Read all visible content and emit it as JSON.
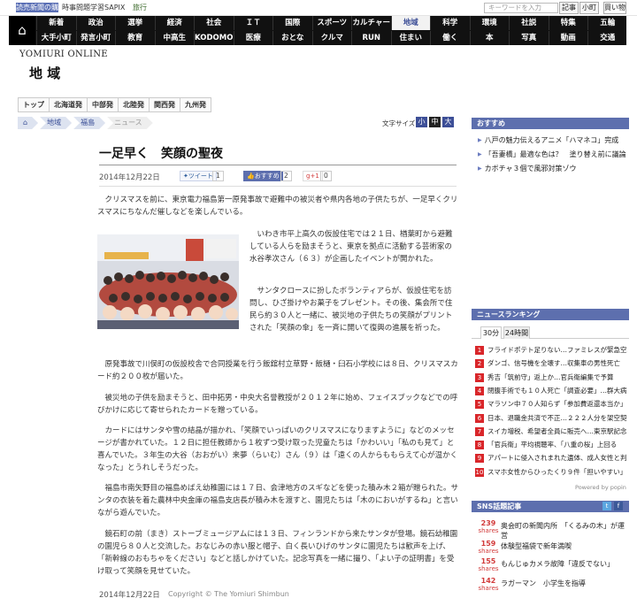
{
  "topbar": {
    "publisher": "読売新聞の購読",
    "links": [
      "時事問題学習SAPIX",
      "旅行"
    ],
    "search_placeholder": "キーワードを入力",
    "buttons": [
      "記事",
      "小町",
      "買い物"
    ]
  },
  "nav": {
    "row1": [
      "新着",
      "政治",
      "選挙",
      "経済",
      "社会",
      "ＩＴ",
      "国際",
      "スポーツ",
      "カルチャー",
      "地域",
      "科学",
      "環境",
      "社説",
      "特集",
      "五輪"
    ],
    "row2": [
      "大手小町",
      "発言小町",
      "教育",
      "中高生",
      "KODOMO",
      "医療",
      "おとな",
      "クルマ",
      "RUN",
      "住まい",
      "働く",
      "本",
      "写真",
      "動画",
      "交通"
    ],
    "active": "地域"
  },
  "brand": "YOMIURI ONLINE",
  "section_title": "地 域",
  "subtabs": [
    "トップ",
    "北海道発",
    "中部発",
    "北陸発",
    "関西発",
    "九州発"
  ],
  "breadcrumb": [
    "",
    "地域",
    "福島",
    "ニュース"
  ],
  "text_size": {
    "label": "文字サイズ",
    "options": [
      "小",
      "中",
      "大"
    ]
  },
  "article": {
    "title": "一足早く　笑顔の聖夜",
    "date": "2014年12月22日",
    "social": [
      {
        "label": "ツイート",
        "count": "1"
      },
      {
        "label": "おすすめ",
        "count": "2"
      },
      {
        "label": "+1",
        "count": "0"
      }
    ],
    "lead": "クリスマスを前に、東京電力福島第一原発事故で避難中の被災者や県内各地の子供たちが、一足早くクリスマスにちなんだ催しなどを楽しんでいる。",
    "p1": "いわき市平上高久の仮設住宅では２１日、楢葉町から避難している人らを励まそうと、東京を拠点に活動する芸術家の水谷孝次さん（６３）が企画したイベントが開かれた。",
    "p2": "サンタクロースに扮したボランティアらが、仮設住宅を訪問し、ひざ掛けやお菓子をプレゼント。その後、集会所で住民ら約３０人と一緒に、被災地の子供たちの笑顔がプリントされた「笑顔の傘」を一斉に開いて復興の進展を祈った。",
    "p3": "原発事故で川俣町の仮設校舎で合同授業を行う飯舘村立草野・飯樋・臼石小学校には８日、クリスマスカード約２００枚が届いた。",
    "p4": "被災地の子供を励まそうと、田中拓男・中央大名誉教授が２０１２年に始め、フェイスブックなどでの呼びかけに応じて寄せられたカードを贈っている。",
    "p5": "カードにはサンタや雪の結晶が描かれ、「笑顔でいっぱいのクリスマスになりますように」などのメッセージが書かれていた。１２日に担任教師から１枚ずつ受け取った児童たちは「かわいい」「私のも見て」と喜んでいた。３年生の大谷（おおがい）来夢（らいむ）さん（９）は「遠くの人からももらえて心が温かくなった」とうれしそうだった。",
    "p6": "福島市南矢野目の福島めばえ幼稚園には１７日、会津地方のスギなどを使った積み木２箱が贈られた。サンタの衣装を着た農林中央金庫の福島支店長が積み木を渡すと、園児たちは「木のにおいがするね」と言いながら遊んでいた。",
    "p7": "鏡石町の前（まき）ストーブミュージアムには１３日、フィンランドから来たサンタが登場。鏡石幼稚園の園児ら８０人と交流した。おなじみの赤い服と帽子、白く長いひげのサンタに園児たちは歓声を上げ、「新幹線のおもちゃをください」などと話しかけていた。記念写真を一緒に撮り、「よい子の証明書」を受け取って笑顔を見せていた。",
    "footer_date": "2014年12月22日",
    "copyright": "Copyright © The Yomiuri Shimbun"
  },
  "sidebar": {
    "recommend_title": "おすすめ",
    "recommend": [
      "八戸の魅力伝えるアニメ「ハマネコ」完成",
      "「吾妻橋」最適な色は？　塗り替え前に議論",
      "カボチャ３個で風邪対策ゾウ"
    ],
    "ranking_title": "ニュースランキング",
    "ranking_tabs": [
      "30分",
      "24時間"
    ],
    "ranking": [
      "フライドポテト足りない…ファミレスが緊急空輸",
      "ダンゴ、信号機を全壊す…収集車の男性死亡",
      "秀吉「筑前守」返上か…官兵衛編集で予算",
      "閉腹手術でも１０人死亡「調査必要」…群大病院",
      "マラソン中７０人知らず「参加費返還本当か」",
      "日本、退職金共済で不正…２２２人分を架空契約",
      "スイカ増税、希望者全員に販売へ…東京駅記念",
      "「官兵衛」平均視聴率、「八重の桜」上回る",
      "アパートに侵入されまれた遺体、成人女性と判明",
      "スマホ女性からひったくり９件「担いやすい」"
    ],
    "powered": "Powered by popin",
    "sns_title": "SNS話題記事",
    "sns": [
      {
        "count": "239",
        "unit": "shares",
        "text": "奥会町の新聞内所　「くるみの木」が運営"
      },
      {
        "count": "159",
        "unit": "shares",
        "text": "体験型福袋で新年満喫"
      },
      {
        "count": "155",
        "unit": "shares",
        "text": "もんじゅカメラ故障「違反でない」"
      },
      {
        "count": "142",
        "unit": "shares",
        "text": "ラガーマン　小学生を指導"
      }
    ],
    "colors": {
      "accent": "#5d6fae",
      "nav_bg": "#111111",
      "rank_badge": "#d9262a"
    }
  }
}
